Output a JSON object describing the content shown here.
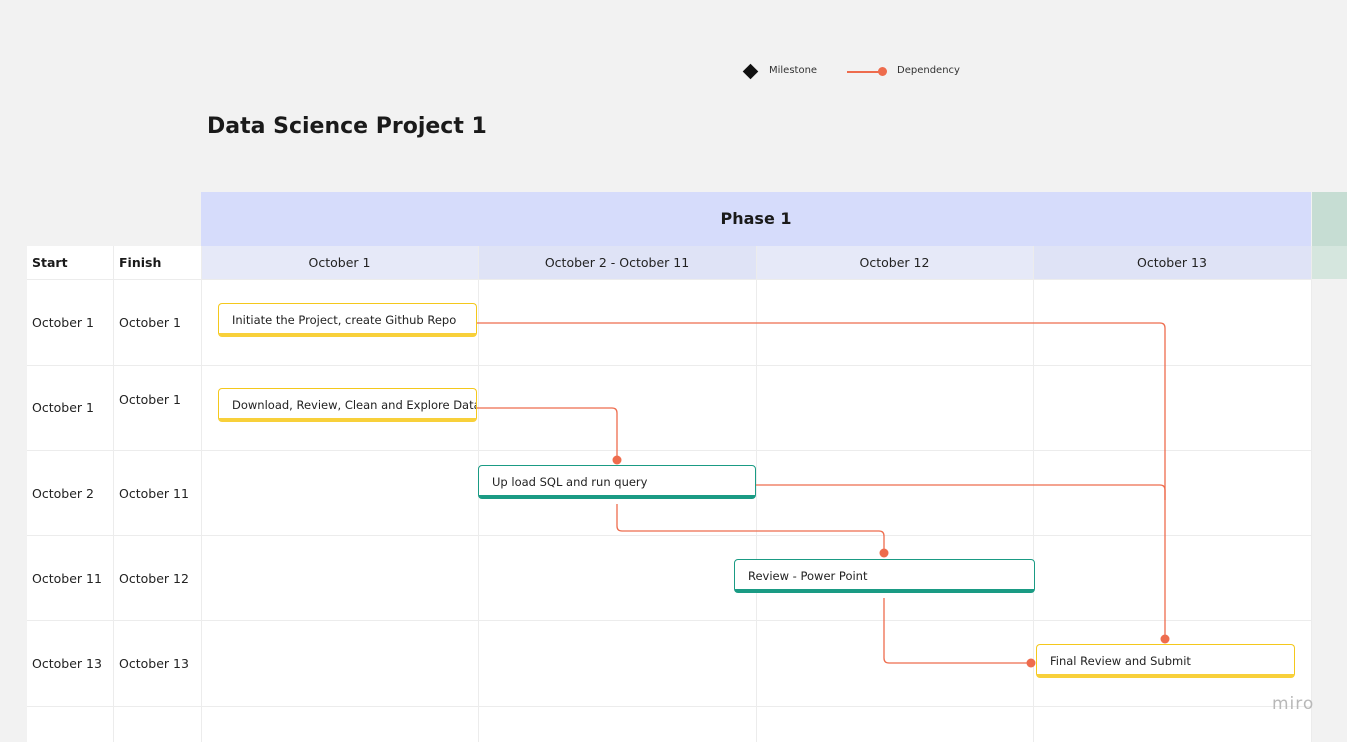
{
  "legend": {
    "milestone_label": "Milestone",
    "dependency_label": "Dependency"
  },
  "title": "Data Science Project 1",
  "phase": {
    "label": "Phase 1"
  },
  "table": {
    "start_header": "Start",
    "finish_header": "Finish",
    "date_columns": [
      "October 1",
      "October 2 - October 11",
      "October 12",
      "October 13"
    ],
    "rows": [
      {
        "start": "October 1",
        "finish": "October 1"
      },
      {
        "start": "October 1",
        "finish": "October 1"
      },
      {
        "start": "October 2",
        "finish": "October 11"
      },
      {
        "start": "October 11",
        "finish": "October 12"
      },
      {
        "start": "October 13",
        "finish": "October 13"
      }
    ]
  },
  "tasks": [
    {
      "label": "Initiate the Project, create Github Repo",
      "color": "yellow"
    },
    {
      "label": "Download, Review, Clean and Explore Data",
      "color": "yellow"
    },
    {
      "label": "Up load SQL and run query",
      "color": "green"
    },
    {
      "label": "Review - Power Point",
      "color": "green"
    },
    {
      "label": "Final Review and Submit",
      "color": "yellow"
    }
  ],
  "colors": {
    "dependency": "#ee6c4d",
    "task_yellow": "#f8d03a",
    "task_green": "#1a9b84",
    "phase_band": "#d6dcfb"
  },
  "brand": "miro"
}
